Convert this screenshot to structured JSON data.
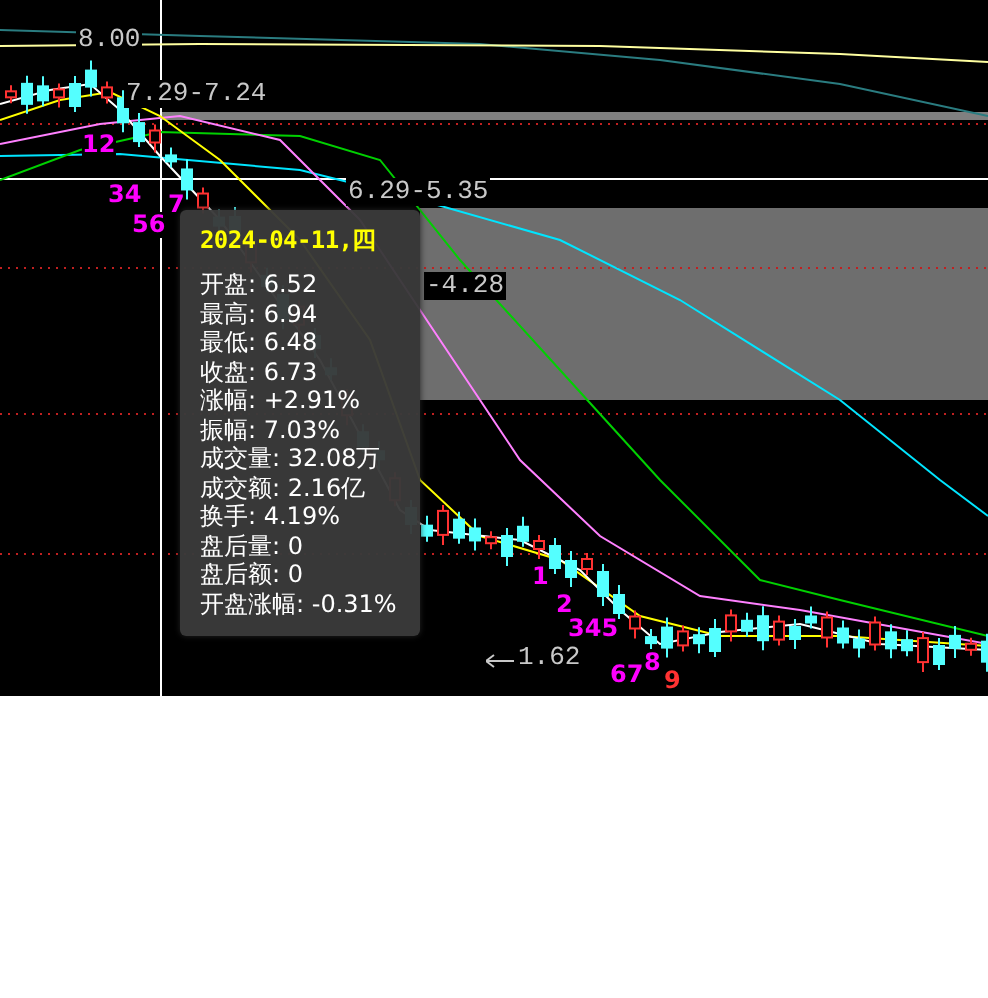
{
  "chart": {
    "price_labels": [
      {
        "text": "8.00"
      },
      {
        "text": "7.29-7.24"
      },
      {
        "text": "6.29-5.35"
      },
      {
        "text": "-4.28"
      },
      {
        "text": "1.62"
      }
    ],
    "markers": [
      {
        "text": "12",
        "color": "#ff00ff"
      },
      {
        "text": "34",
        "color": "#ff00ff"
      },
      {
        "text": "56",
        "color": "#ff00ff"
      },
      {
        "text": "7",
        "color": "#ff00ff"
      },
      {
        "text": "1",
        "color": "#ff00ff"
      },
      {
        "text": "2",
        "color": "#ff00ff"
      },
      {
        "text": "345",
        "color": "#ff00ff"
      },
      {
        "text": "67",
        "color": "#ff00ff"
      },
      {
        "text": "8",
        "color": "#ff00ff"
      },
      {
        "text": "9",
        "color": "#ff3232"
      }
    ]
  },
  "tooltip": {
    "date": "2024-04-11,四",
    "rows": [
      "开盘: 6.52",
      "最高: 6.94",
      "最低: 6.48",
      "收盘: 6.73",
      "涨幅: +2.91%",
      "振幅: 7.03%",
      "成交量: 32.08万",
      "成交额: 2.16亿",
      "换手: 4.19%",
      "盘后量: 0",
      "盘后额: 0",
      "开盘涨幅: -0.31%"
    ]
  }
}
